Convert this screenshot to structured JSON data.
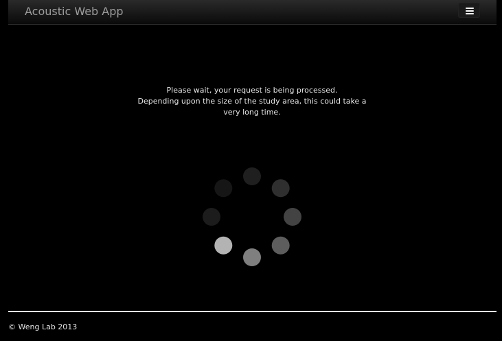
{
  "navbar": {
    "brand": "Acoustic Web App",
    "menu_icon": "hamburger-menu-icon"
  },
  "message": {
    "line1": "Please wait, your request is being processed.",
    "line2": "Depending upon the size of the study area, this could take a",
    "line3": "very long time."
  },
  "spinner": {
    "icon": "loading-spinner-icon",
    "dot_colors": [
      "#1f1f1f",
      "#2f2f2f",
      "#434343",
      "#5d5d5d",
      "#7f7f7f",
      "#b3b3b3",
      "#1c1c1c",
      "#161616"
    ]
  },
  "footer": {
    "text": "© Weng Lab 2013"
  }
}
